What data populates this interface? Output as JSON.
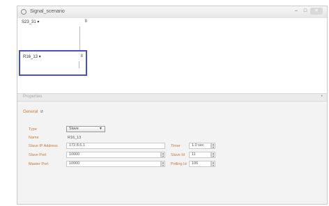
{
  "window": {
    "title": "Signal_scenario"
  },
  "canvas": {
    "top_node": {
      "label": "S23_31 ▾",
      "port": "8"
    },
    "selected_node": {
      "label": "R16_13 ▾",
      "port": "8"
    }
  },
  "properties": {
    "header": "Properties",
    "section": "General",
    "section_toggle": "⊘",
    "fields": {
      "type": {
        "label": "Type",
        "value": "Slave"
      },
      "name": {
        "label": "Name",
        "value": "R16_13"
      },
      "slave_ip": {
        "label": "Slave IP Address",
        "value": "172.8.6.1"
      },
      "slave_port": {
        "label": "Slave Port",
        "value": "10000"
      },
      "master_port": {
        "label": "Master Port",
        "value": "10000"
      },
      "timer": {
        "label": "Timer",
        "value": "1.0 sec"
      },
      "slave_id": {
        "label": "Slave Id",
        "value": "11"
      },
      "polling_id": {
        "label": "Polling Id",
        "value": "106"
      }
    }
  }
}
